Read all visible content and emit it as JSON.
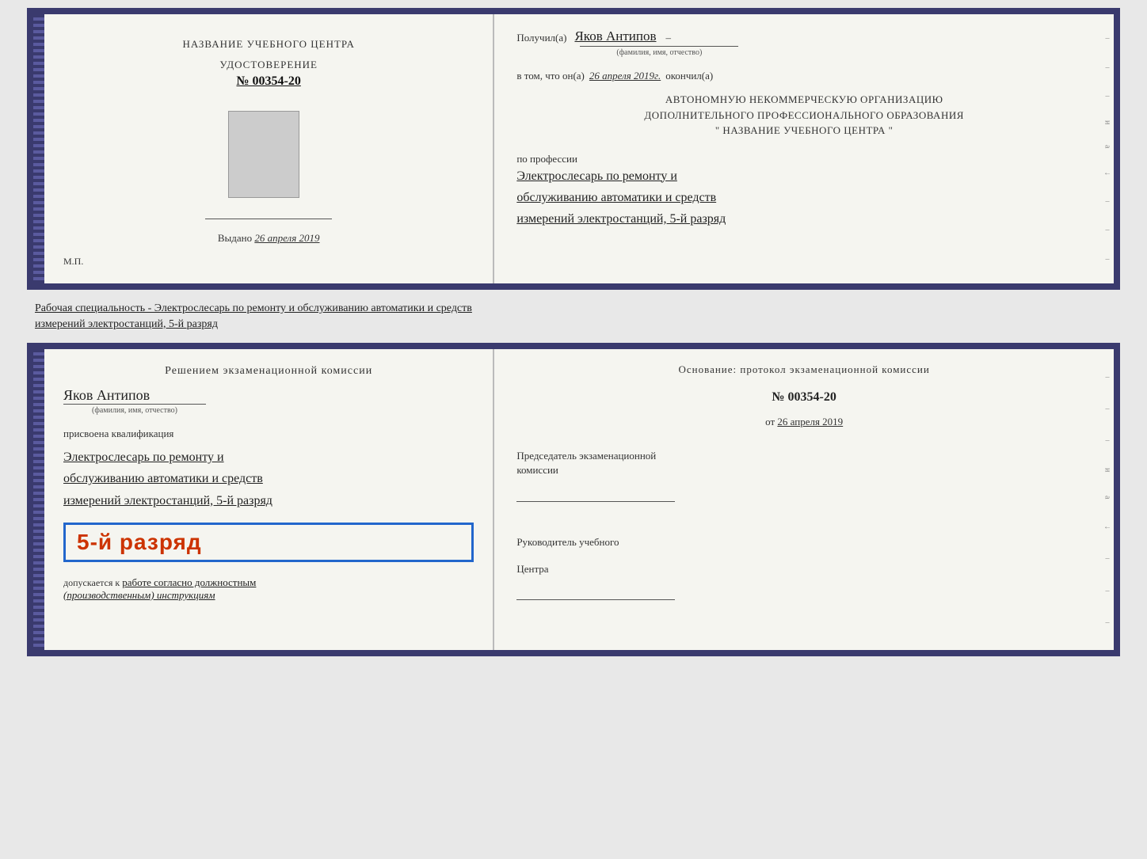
{
  "top_book": {
    "left": {
      "title": "НАЗВАНИЕ УЧЕБНОГО ЦЕНТРА",
      "cert_label": "УДОСТОВЕРЕНИЕ",
      "cert_number": "№ 00354-20",
      "issued_label": "Выдано",
      "issued_date": "26 апреля 2019",
      "mp": "М.П."
    },
    "right": {
      "received_label": "Получил(а)",
      "recipient_name": "Яков Антипов",
      "fio_hint": "(фамилия, имя, отчество)",
      "confirm_label": "в том, что он(а)",
      "confirm_date": "26 апреля 2019г.",
      "confirm_end": "окончил(а)",
      "org_line1": "АВТОНОМНУЮ НЕКОММЕРЧЕСКУЮ ОРГАНИЗАЦИЮ",
      "org_line2": "ДОПОЛНИТЕЛЬНОГО ПРОФЕССИОНАЛЬНОГО ОБРАЗОВАНИЯ",
      "org_line3": "\" НАЗВАНИЕ УЧЕБНОГО ЦЕНТРА \"",
      "profession_label": "по профессии",
      "profession_line1": "Электрослесарь по ремонту и",
      "profession_line2": "обслуживанию автоматики и средств",
      "profession_line3": "измерений электростанций, 5-й разряд"
    },
    "right_marks": [
      "–",
      "–",
      "–",
      "и",
      "а",
      "←",
      "–",
      "–",
      "–"
    ]
  },
  "specialty_text": "Рабочая специальность - Электрослесарь по ремонту и обслуживанию автоматики и средств",
  "specialty_text2": "измерений электростанций, 5-й разряд",
  "bottom_book": {
    "left": {
      "commission_title": "Решением экзаменационной комиссии",
      "name": "Яков Антипов",
      "fio_hint": "(фамилия, имя, отчество)",
      "qualification_label": "присвоена квалификация",
      "qual_line1": "Электрослесарь по ремонту и",
      "qual_line2": "обслуживанию автоматики и средств",
      "qual_line3": "измерений электростанций, 5-й разряд",
      "rank_stamp": "5-й разряд",
      "allowed_label": "допускается к",
      "allowed_handwritten": "работе согласно должностным",
      "allowed_handwritten2": "(производственным) инструкциям"
    },
    "right": {
      "basis_label": "Основание: протокол экзаменационной комиссии",
      "protocol_number": "№ 00354-20",
      "protocol_date_prefix": "от",
      "protocol_date": "26 апреля 2019",
      "chairman_title": "Председатель экзаменационной",
      "chairman_title2": "комиссии",
      "head_title": "Руководитель учебного",
      "head_title2": "Центра"
    },
    "right_marks": [
      "–",
      "–",
      "–",
      "и",
      "а",
      "←",
      "–",
      "–",
      "–"
    ]
  }
}
